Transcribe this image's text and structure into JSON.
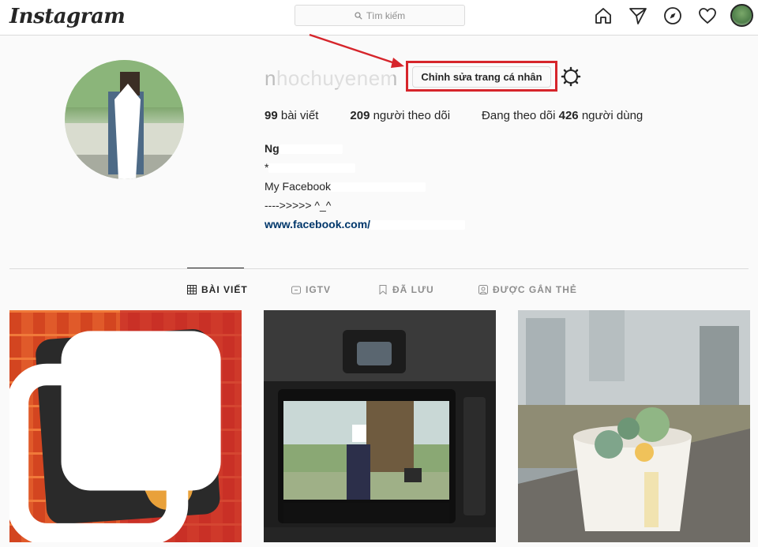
{
  "nav": {
    "logo": "Instagram",
    "search_placeholder": "Tìm kiếm",
    "icons": [
      "home-icon",
      "direct-icon",
      "explore-icon",
      "activity-icon",
      "profile-avatar"
    ]
  },
  "profile": {
    "username": "nhochuyenem",
    "edit_label": "Chỉnh sửa trang cá nhân",
    "stats": [
      {
        "count": "99",
        "label": "bài viết",
        "pre": ""
      },
      {
        "count": "209",
        "label": "người theo dõi",
        "pre": ""
      },
      {
        "count": "426",
        "label": "người dùng",
        "pre": "Đang theo dõi"
      }
    ],
    "bio": {
      "name": "Ng",
      "line2": "*",
      "line3": "My Facebook",
      "line4": "---->>>>> ^_^",
      "link": "www.facebook.com/"
    }
  },
  "tabs": [
    {
      "label": "BÀI VIẾT",
      "icon": "grid-icon",
      "active": true
    },
    {
      "label": "IGTV",
      "icon": "igtv-icon",
      "active": false
    },
    {
      "label": "ĐÃ LƯU",
      "icon": "bookmark-icon",
      "active": false
    },
    {
      "label": "ĐƯỢC GẮN THẺ",
      "icon": "tagged-icon",
      "active": false
    }
  ],
  "colors": {
    "highlight": "#d6252b",
    "link": "#00376b",
    "border": "#dbdbdb"
  }
}
